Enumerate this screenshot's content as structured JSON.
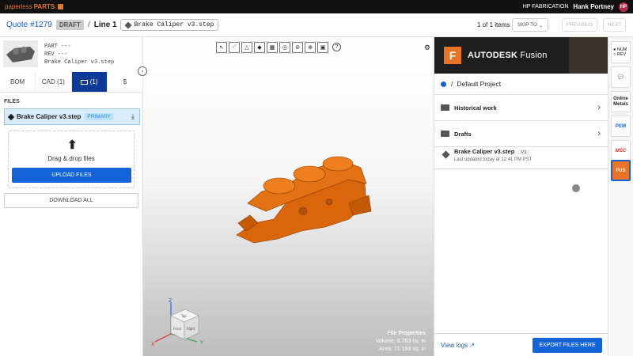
{
  "topbar": {
    "brand_a": "paperless",
    "brand_b": "PARTS",
    "company": "HP FABRICATION",
    "user": "Hank Portney",
    "avatar": "HP"
  },
  "header": {
    "quote": "Quote #1279",
    "status": "DRAFT",
    "line": "Line 1",
    "file_chip": "Brake Caliper v3.step",
    "items": "1 of 1 items",
    "skip_to": "SKIP TO",
    "previous": "PREVIOUS",
    "next": "NEXT"
  },
  "left": {
    "part": "PART ---",
    "rev": "REV  ---",
    "file": "Brake Caliper v3.step",
    "tabs": [
      "BOM",
      "CAD (1)",
      "(1)",
      "$"
    ],
    "files_label": "FILES",
    "file_name": "Brake Caliper v3.step",
    "primary": "PRIMARY",
    "drop_text": "Drag & drop files",
    "upload": "UPLOAD FILES",
    "download_all": "DOWNLOAD ALL"
  },
  "viewer": {
    "props_title": "File Properties",
    "volume": "Volume: 8.763 cu. in",
    "area": "Area: 71.193 sq. in",
    "axis_x": "X",
    "axis_y": "Y",
    "axis_z": "Z",
    "cube_top": "Top",
    "cube_front": "Front",
    "cube_right": "Right",
    "part_color": "#d9660a"
  },
  "right": {
    "brand": "AUTODESK",
    "product": "Fusion",
    "project": "Default Project",
    "folders": [
      "Historical work",
      "Drafts"
    ],
    "file_name": "Brake Caliper v3.step",
    "file_version": "V1",
    "file_updated": "Last updated today at 12:41 PM PST",
    "view_logs": "View logs",
    "export": "EXPORT FILES HERE"
  },
  "rail": {
    "num": "NUM",
    "rev": "REV",
    "online_metals": "Online Metals",
    "msc": "MSC",
    "fus": "FUS"
  },
  "colors": {
    "accent": "#1563d9",
    "brand_orange": "#e8742a"
  }
}
